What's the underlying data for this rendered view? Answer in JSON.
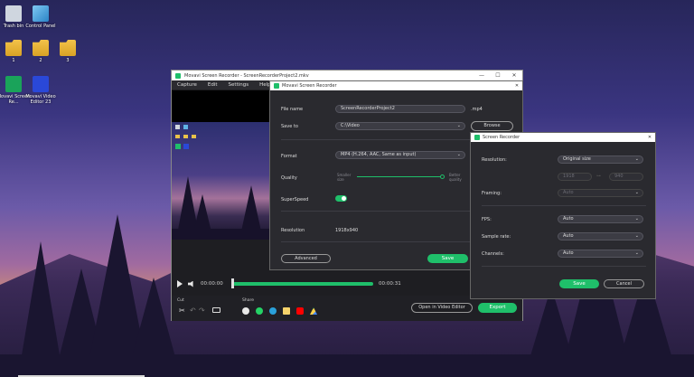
{
  "desktop": {
    "icons": [
      {
        "name": "trash-bin-icon",
        "label": "Trash bin",
        "kind": "trash"
      },
      {
        "name": "control-panel-icon",
        "label": "Control Panel",
        "kind": "cpanel"
      },
      {
        "name": "folder-1-icon",
        "label": "1",
        "kind": "folder"
      },
      {
        "name": "folder-2-icon",
        "label": "2",
        "kind": "folder"
      },
      {
        "name": "folder-3-icon",
        "label": "3",
        "kind": "folder"
      },
      {
        "name": "movavi-screen-recorder-icon",
        "label": "Movavi Screen Re...",
        "kind": "movapp"
      },
      {
        "name": "movavi-video-editor-icon",
        "label": "Movavi Video Editor 23",
        "kind": "movvid"
      }
    ]
  },
  "main_window": {
    "title": "Movavi Screen Recorder - ScreenRecorderProject2.mkv",
    "minimize": "—",
    "maximize": "☐",
    "close": "✕",
    "menu": [
      "Capture",
      "Edit",
      "Settings",
      "Help"
    ],
    "time_current": "00:00:00",
    "time_total": "00:00:31",
    "cut_label": "Cut",
    "share_label": "Share",
    "open_in_editor": "Open in Video Editor",
    "export": "Export"
  },
  "settings_dialog": {
    "title": "Movavi Screen Recorder",
    "close": "✕",
    "file_name_label": "File name",
    "file_name_value": "ScreenRecorderProject2",
    "file_ext": ".mp4",
    "save_to_label": "Save to",
    "save_to_value": "C:\\Video",
    "browse": "Browse",
    "format_label": "Format",
    "format_value": "MP4 (H.264, AAC, Same as input)",
    "quality_label": "Quality",
    "quality_min": "Smaller size",
    "quality_max": "Better quality",
    "superspeed_label": "SuperSpeed",
    "superspeed_on": true,
    "resolution_label": "Resolution",
    "resolution_value": "1918x940",
    "advanced": "Advanced",
    "save": "Save"
  },
  "recorder_dialog": {
    "title": "Screen Recorder",
    "close": "✕",
    "resolution_label": "Resolution:",
    "resolution_value": "Original size",
    "width_value": "1918",
    "height_value": "940",
    "framing_label": "Framing:",
    "framing_value": "Auto",
    "fps_label": "FPS:",
    "fps_value": "Auto",
    "sample_rate_label": "Sample rate:",
    "sample_rate_value": "Auto",
    "channels_label": "Channels:",
    "channels_value": "Auto",
    "save": "Save",
    "cancel": "Cancel"
  },
  "colors": {
    "accent": "#1fbf6a",
    "dialog_bg": "#2a2a2f"
  }
}
